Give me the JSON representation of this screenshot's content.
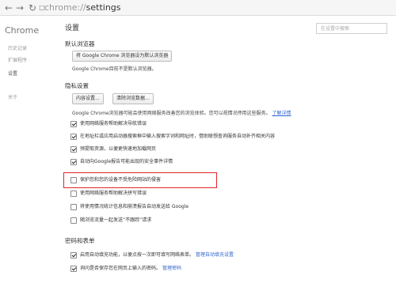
{
  "topbar": {
    "address_scheme": "chrome://",
    "address_path": "settings"
  },
  "sidebar": {
    "brand": "Chrome",
    "items": [
      {
        "label": "历史记录"
      },
      {
        "label": "扩展程序"
      },
      {
        "label": "设置"
      },
      {
        "label": "关于"
      }
    ]
  },
  "main": {
    "title": "设置",
    "search_placeholder": "在设置中搜索",
    "default_browser": {
      "title": "默认浏览器",
      "button": "将 Google Chrome 浏览器设为默认浏览器",
      "status": "Google Chrome目前不是默认浏览器。"
    },
    "privacy": {
      "title": "隐私设置",
      "content_settings_button": "内容设置...",
      "clear_data_button": "清除浏览数据...",
      "description": "Google Chrome浏览器可能会使用网络服务改善您的浏览体验。您可以视情况停用这些服务。",
      "learn_more": "了解详情",
      "options": [
        {
          "label": "使用网络服务帮助解决导航错误",
          "checked": true
        },
        {
          "label": "在地址栏或应用启动器搜索框中输入搜索字词和网址时，借助联想查询服务自动补齐相关内容",
          "checked": true
        },
        {
          "label": "预提取资源，以便更快速地加载网页",
          "checked": true
        },
        {
          "label": "自动向Google报告可能出现的安全事件详情",
          "checked": true
        },
        {
          "label": "保护您和您的设备不受危险网站的侵害",
          "checked": false
        },
        {
          "label": "使用网络服务帮助解决拼写错误",
          "checked": false
        },
        {
          "label": "将使用情况统计信息和崩溃报告自动发送给 Google",
          "checked": false
        },
        {
          "label": "随浏览流量一起发送“不跟踪”请求",
          "checked": false
        }
      ]
    },
    "passwords": {
      "title": "密码和表单",
      "options": [
        {
          "label": "启用自动填充功能，以便点按一次即可填写网络表单。",
          "link": "管理自动填充设置",
          "checked": true
        },
        {
          "label": "询问是否保存您在网页上输入的密码。",
          "link": "管理密码",
          "checked": true
        }
      ]
    }
  }
}
